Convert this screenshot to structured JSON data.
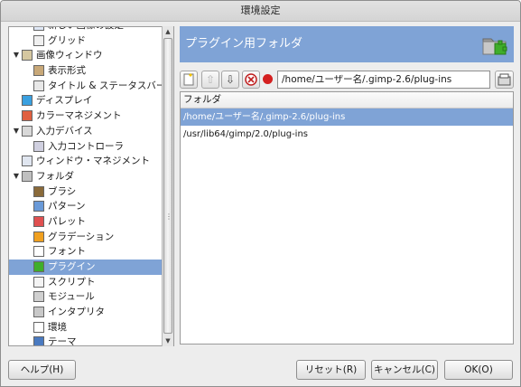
{
  "window": {
    "title": "環境設定"
  },
  "sidebar": {
    "items": [
      {
        "label": "新しい画像の設定",
        "level": 1,
        "expander": "",
        "icon": "new-image-icon"
      },
      {
        "label": "グリッド",
        "level": 1,
        "expander": "",
        "icon": "grid-icon"
      },
      {
        "label": "画像ウィンドウ",
        "level": 0,
        "expander": "▼",
        "icon": "image-window-icon"
      },
      {
        "label": "表示形式",
        "level": 1,
        "expander": "",
        "icon": "appearance-icon"
      },
      {
        "label": "タイトル & ステータスバー",
        "level": 1,
        "expander": "",
        "icon": "title-statusbar-icon"
      },
      {
        "label": "ディスプレイ",
        "level": 0,
        "expander": "",
        "icon": "display-icon"
      },
      {
        "label": "カラーマネジメント",
        "level": 0,
        "expander": "",
        "icon": "color-management-icon"
      },
      {
        "label": "入力デバイス",
        "level": 0,
        "expander": "▼",
        "icon": "input-devices-icon"
      },
      {
        "label": "入力コントローラ",
        "level": 1,
        "expander": "",
        "icon": "input-controllers-icon"
      },
      {
        "label": "ウィンドウ・マネジメント",
        "level": 0,
        "expander": "",
        "icon": "window-management-icon"
      },
      {
        "label": "フォルダ",
        "level": 0,
        "expander": "▼",
        "icon": "folder-icon"
      },
      {
        "label": "ブラシ",
        "level": 1,
        "expander": "",
        "icon": "brush-icon"
      },
      {
        "label": "パターン",
        "level": 1,
        "expander": "",
        "icon": "pattern-icon"
      },
      {
        "label": "パレット",
        "level": 1,
        "expander": "",
        "icon": "palette-icon"
      },
      {
        "label": "グラデーション",
        "level": 1,
        "expander": "",
        "icon": "gradient-icon"
      },
      {
        "label": "フォント",
        "level": 1,
        "expander": "",
        "icon": "font-icon"
      },
      {
        "label": "プラグイン",
        "level": 1,
        "expander": "",
        "icon": "plugin-icon",
        "selected": true
      },
      {
        "label": "スクリプト",
        "level": 1,
        "expander": "",
        "icon": "script-icon"
      },
      {
        "label": "モジュール",
        "level": 1,
        "expander": "",
        "icon": "module-icon"
      },
      {
        "label": "インタプリタ",
        "level": 1,
        "expander": "",
        "icon": "interpreter-icon"
      },
      {
        "label": "環境",
        "level": 1,
        "expander": "",
        "icon": "environment-icon"
      },
      {
        "label": "テーマ",
        "level": 1,
        "expander": "",
        "icon": "theme-icon"
      }
    ]
  },
  "panel": {
    "title": "プラグイン用フォルダ",
    "header_icon": "plugin-folder-icon",
    "path_value": "/home/ユーザー名/.gimp-2.6/plug-ins",
    "list_header": "フォルダ",
    "folders": [
      {
        "path": "/home/ユーザー名/.gimp-2.6/plug-ins",
        "selected": true
      },
      {
        "path": "/usr/lib64/gimp/2.0/plug-ins",
        "selected": false
      }
    ],
    "toolbar": {
      "add_icon": "new-folder-icon",
      "up_icon": "move-up-icon",
      "down_icon": "move-down-icon",
      "delete_icon": "delete-icon",
      "status_icon": "status-red-dot-icon",
      "browse_icon": "browse-folder-icon"
    }
  },
  "buttons": {
    "help": "ヘルプ(H)",
    "reset": "リセット(R)",
    "cancel": "キャンセル(C)",
    "ok": "OK(O)"
  },
  "colors": {
    "selection": "#7fa3d6",
    "status_dot": "#d42020"
  }
}
